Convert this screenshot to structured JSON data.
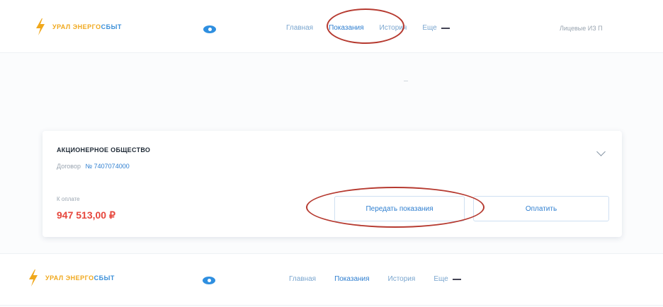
{
  "header": {
    "logo": {
      "part_a": "УРАЛ ЭНЕРГО",
      "part_b": "СБЫТ"
    },
    "nav": [
      "Главная",
      "Показания",
      "История",
      "Еще"
    ],
    "account": "Лицевые ИЗ П"
  },
  "card": {
    "org": "АКЦИОНЕРНОЕ ОБЩЕСТВО",
    "contract_label": "Договор",
    "contract_number": "№ 7407074000",
    "pay_label": "К оплате",
    "amount": "947 513,00 ₽",
    "primary_button": "Передать показания",
    "secondary_button": "Оплатить"
  },
  "header_bottom": {
    "logo": {
      "part_a": "УРАЛ ЭНЕРГО",
      "part_b": "СБЫТ"
    },
    "nav": [
      "Главная",
      "Показания",
      "История",
      "Еще"
    ]
  },
  "icons": {
    "logo": "lightning-bolt-icon",
    "eye": "eye-icon",
    "chevron": "chevron-down-icon",
    "more": "dash-icon"
  },
  "colors": {
    "accent_blue": "#2f7fd0",
    "amount_red": "#e6463c",
    "logo_orange": "#f0a81c",
    "annotation_red": "#b63a30"
  }
}
